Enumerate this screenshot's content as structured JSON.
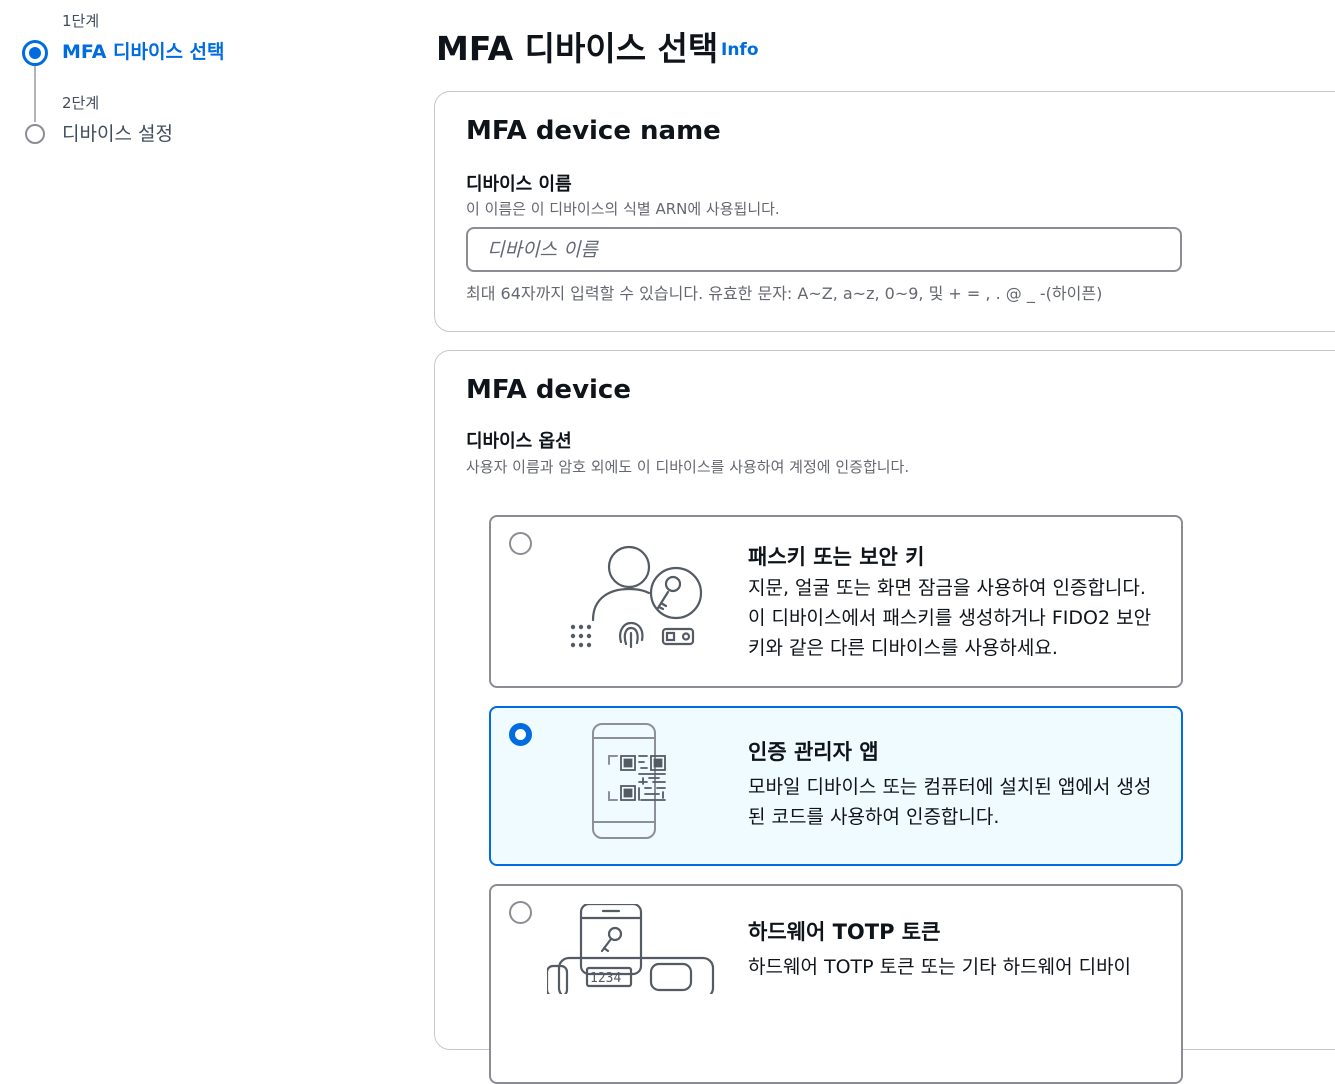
{
  "steps": [
    {
      "number": "1단계",
      "title": "MFA 디바이스 선택",
      "state": "active"
    },
    {
      "number": "2단계",
      "title": "디바이스 설정",
      "state": "inactive"
    }
  ],
  "header": {
    "title": "MFA 디바이스 선택",
    "info_label": "Info"
  },
  "name_section": {
    "header": "MFA device name",
    "field_label": "디바이스 이름",
    "field_description": "이 이름은 이 디바이스의 식별 ARN에 사용됩니다.",
    "input_value": "",
    "input_placeholder": "디바이스 이름",
    "constraint": "최대 64자까지 입력할 수 있습니다. 유효한 문자: A~Z, a~z, 0~9, 및 + = , . @ _ -(하이픈)"
  },
  "device_section": {
    "header": "MFA device",
    "field_label": "디바이스 옵션",
    "field_description": "사용자 이름과 암호 외에도 이 디바이스를 사용하여 계정에 인증합니다.",
    "options": [
      {
        "title": "패스키 또는 보안 키",
        "description": "지문, 얼굴 또는 화면 잠금을 사용하여 인증합니다. 이 디바이스에서 패스키를 생성하거나 FIDO2 보안 키와 같은 다른 디바이스를 사용하세요.",
        "icon": "passkey-icon",
        "selected": false
      },
      {
        "title": "인증 관리자 앱",
        "description": "모바일 디바이스 또는 컴퓨터에 설치된 앱에서 생성된 코드를 사용하여 인증합니다.",
        "icon": "authenticator-app-icon",
        "selected": true
      },
      {
        "title": "하드웨어 TOTP 토큰",
        "description": "하드웨어 TOTP 토큰 또는 기타 하드웨어 디바이",
        "icon": "hardware-token-icon",
        "token_display": "1234",
        "selected": false
      }
    ]
  },
  "colors": {
    "accent": "#006ce0",
    "selected_background": "#f0fbff",
    "border": "#8c8c94",
    "text_secondary": "#656871"
  }
}
